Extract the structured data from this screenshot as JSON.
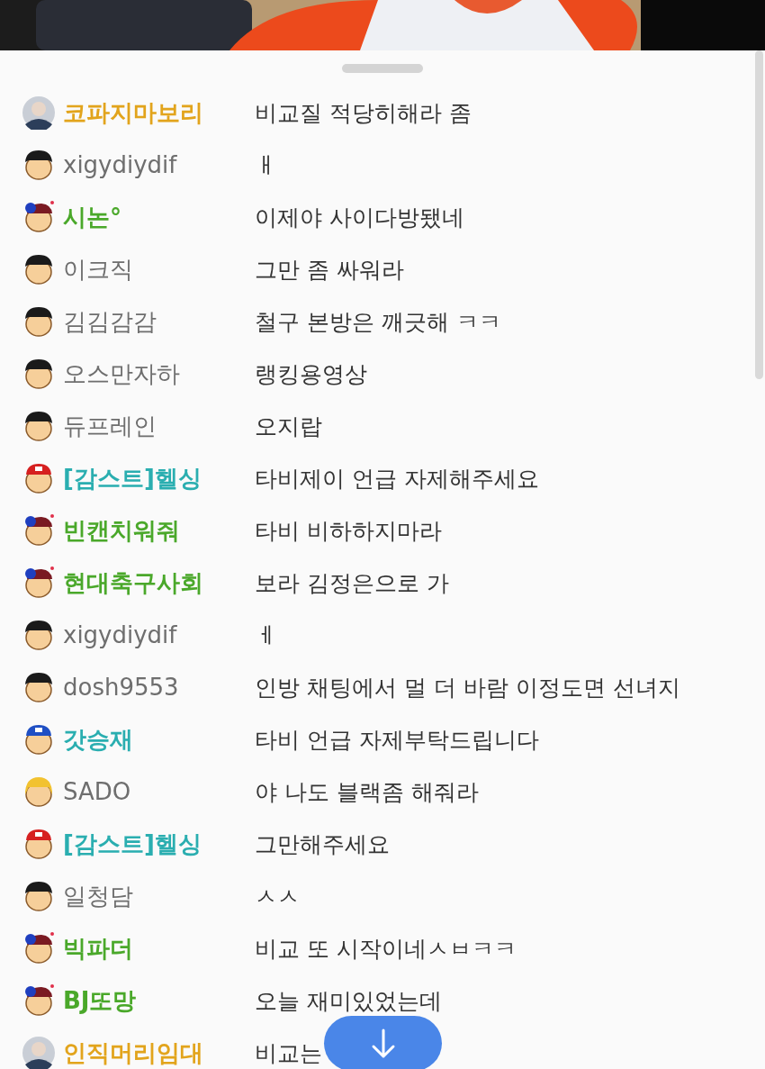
{
  "chat": {
    "messages": [
      {
        "name": "코파지마보리",
        "color": "#e2a41c",
        "text": "비교질 적당히해라 좀"
      },
      {
        "kind": "basic",
        "name": "xigydiydif",
        "color": "#6e6e6e",
        "text": "ㅐ"
      },
      {
        "kind": "fan",
        "name": "시논°",
        "color": "#4aa82a",
        "text": "이제야 사이다방됐네"
      },
      {
        "kind": "basic",
        "name": "이크직",
        "color": "#6e6e6e",
        "text": "그만 좀 싸워라"
      },
      {
        "kind": "basic",
        "name": "김김감감",
        "color": "#6e6e6e",
        "text": "철구 본방은 깨긋해 ㅋㅋ"
      },
      {
        "kind": "basic",
        "name": "오스만자하",
        "color": "#6e6e6e",
        "text": "랭킹용영상"
      },
      {
        "kind": "basic",
        "name": "듀프레인",
        "color": "#6e6e6e",
        "text": "오지랍"
      },
      {
        "kind": "manager",
        "name": "[감스트]헬싱",
        "color": "#2aaeb0",
        "text": "타비제이 언급 자제해주세요"
      },
      {
        "kind": "fan",
        "name": "빈캔치워줘",
        "color": "#4aa82a",
        "text": "타비 비하하지마라"
      },
      {
        "kind": "fan",
        "name": "현대축구사회",
        "color": "#4aa82a",
        "text": "보라 김정은으로 가"
      },
      {
        "kind": "basic",
        "name": "xigydiydif",
        "color": "#6e6e6e",
        "text": "ㅔ"
      },
      {
        "kind": "basic",
        "name": "dosh9553",
        "color": "#6e6e6e",
        "text": "인방 채팅에서 멀 더 바람 이정도면 선녀지"
      },
      {
        "kind": "supporter",
        "name": "갓승재",
        "color": "#2aaeb0",
        "text": "타비 언급 자제부탁드립니다"
      },
      {
        "kind": "female",
        "name": "SADO",
        "color": "#6e6e6e",
        "text": "야 나도 블랙좀 해줘라"
      },
      {
        "kind": "manager",
        "name": "[감스트]헬싱",
        "color": "#2aaeb0",
        "text": "그만해주세요"
      },
      {
        "kind": "basic",
        "name": "일청담",
        "color": "#6e6e6e",
        "text": "ㅅㅅ"
      },
      {
        "kind": "fan",
        "name": "빅파더",
        "color": "#4aa82a",
        "text": "비교 또 시작이네ㅅㅂㅋㅋ"
      },
      {
        "kind": "fan",
        "name": "BJ또망",
        "color": "#4aa82a",
        "text": "오늘 재미있었는데"
      },
      {
        "name": "인직머리임대",
        "color": "#e2a41c",
        "text": "비교는"
      }
    ]
  }
}
